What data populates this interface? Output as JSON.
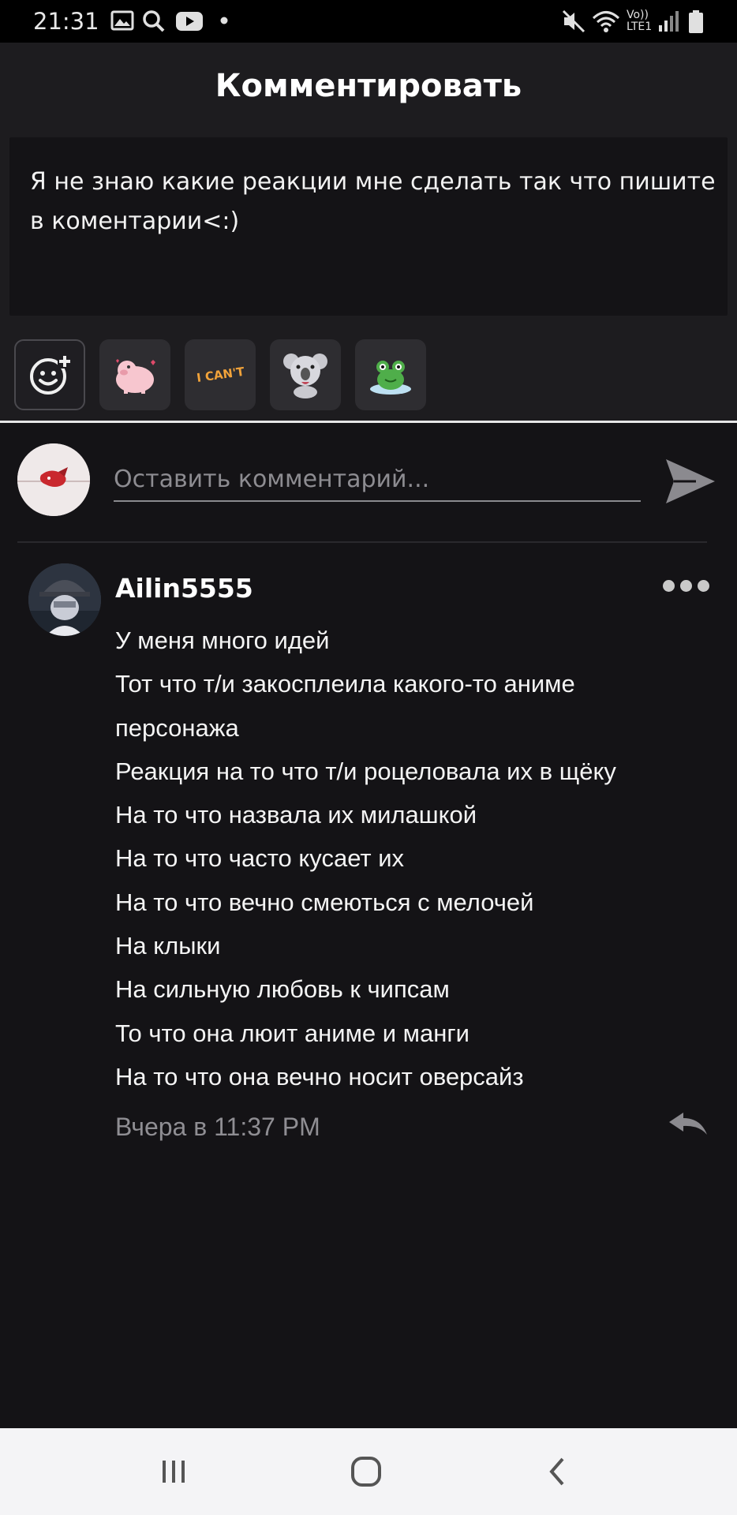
{
  "status_bar": {
    "time": "21:31",
    "icons": [
      "gallery-icon",
      "search-icon",
      "youtube-icon",
      "dot-icon",
      "mute-icon",
      "wifi-icon",
      "volte-icon",
      "signal-icon",
      "battery-icon"
    ],
    "volte_label": "Vo)) LTE1"
  },
  "header": {
    "title": "Комментировать"
  },
  "post": {
    "text": "Я не знаю какие реакции мне сделать так что пишите в коментарии<:)"
  },
  "stickers": {
    "items": [
      "add-sticker-icon",
      "pig-sticker",
      "i-cant-sticker",
      "koala-sticker",
      "frog-sticker"
    ],
    "i_cant_label": "I CAN'T"
  },
  "comment_input": {
    "placeholder": "Оставить комментарий...",
    "send_icon": "send-icon"
  },
  "comment": {
    "author": "Ailin5555",
    "lines": [
      "У меня много идей",
      "Тот что т/и закосплеила какого-то аниме",
      "персонажа",
      "Реакция на то что т/и роцеловала их в щёку",
      "На то что назвала их милашкой",
      "На то что часто кусает их",
      "На то что вечно смеються с мелочей",
      "На клыки",
      "На сильную любовь к чипсам",
      "То что она люит аниме и манги",
      "На то что она вечно носит оверсайз"
    ],
    "time": "Вчера в 11:37 PM",
    "more_icon": "more-icon",
    "reply_icon": "reply-icon"
  },
  "nav_bar": {
    "buttons": [
      "recent-apps-icon",
      "home-icon",
      "back-icon"
    ]
  },
  "colors": {
    "background": "#141316",
    "panel": "#1d1c1f",
    "muted_text": "#8f8e93",
    "nav_bar": "#f4f4f6"
  }
}
